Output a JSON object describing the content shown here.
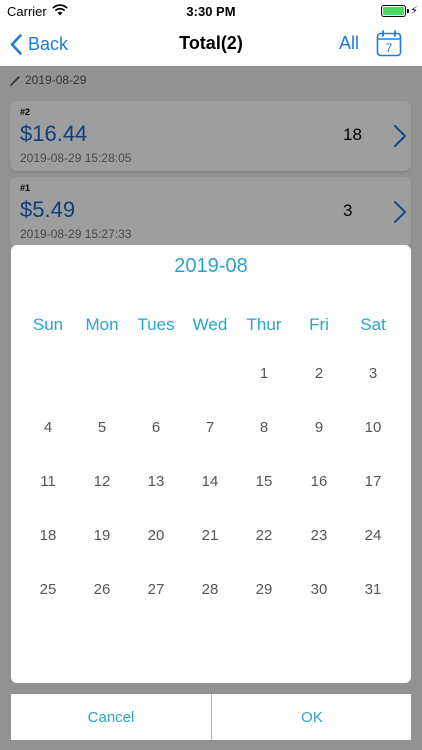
{
  "status_bar": {
    "carrier": "Carrier",
    "time": "3:30 PM",
    "wifi_icon": "wifi-icon",
    "battery_icon": "battery-icon",
    "charging_icon": "bolt-icon",
    "bolt_glyph": "⚡"
  },
  "nav": {
    "back_label": "Back",
    "title": "Total(2)",
    "all_label": "All",
    "calendar_day": "7",
    "calendar_icon": "calendar-icon"
  },
  "list": {
    "section_date": "2019-08-29",
    "section_icon": "magic-wand-icon",
    "items": [
      {
        "number": "#2",
        "amount": "$16.44",
        "timestamp": "2019-08-29 15:28:05",
        "count": "18"
      },
      {
        "number": "#1",
        "amount": "$5.49",
        "timestamp": "2019-08-29 15:27:33",
        "count": "3"
      }
    ]
  },
  "picker": {
    "month": "2019-08",
    "weekdays": [
      "Sun",
      "Mon",
      "Tues",
      "Wed",
      "Thur",
      "Fri",
      "Sat"
    ],
    "first_weekday_index": 4,
    "days": [
      "1",
      "2",
      "3",
      "4",
      "5",
      "6",
      "7",
      "8",
      "9",
      "10",
      "11",
      "12",
      "13",
      "14",
      "15",
      "16",
      "17",
      "18",
      "19",
      "20",
      "21",
      "22",
      "23",
      "24",
      "25",
      "26",
      "27",
      "28",
      "29",
      "30",
      "31"
    ],
    "cancel_label": "Cancel",
    "ok_label": "OK"
  },
  "colors": {
    "accent": "#2aa3c9",
    "link": "#1e7be0",
    "amount": "#1a67c8",
    "battery": "#4cd964"
  }
}
